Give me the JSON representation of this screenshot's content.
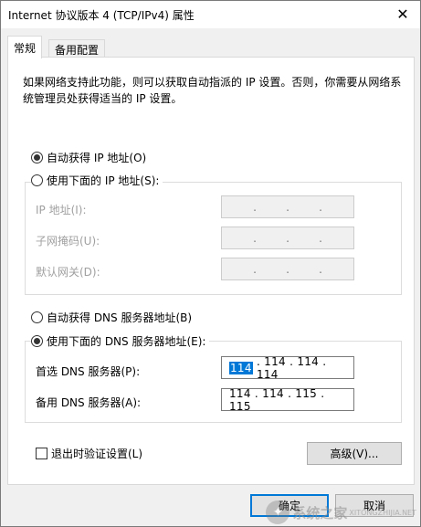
{
  "window": {
    "title": "Internet 协议版本 4 (TCP/IPv4) 属性",
    "close_glyph": "✕"
  },
  "tabs": [
    {
      "label": "常规",
      "active": true
    },
    {
      "label": "备用配置",
      "active": false
    }
  ],
  "description": "如果网络支持此功能，则可以获取自动指派的 IP 设置。否则，你需要从网络系统管理员处获得适当的 IP 设置。",
  "ip_section": {
    "auto_label": "自动获得 IP 地址(O)",
    "auto_checked": true,
    "manual_label": "使用下面的 IP 地址(S):",
    "manual_checked": false,
    "fields": [
      {
        "label": "IP 地址(I):",
        "value": "",
        "enabled": false
      },
      {
        "label": "子网掩码(U):",
        "value": "",
        "enabled": false
      },
      {
        "label": "默认网关(D):",
        "value": "",
        "enabled": false
      }
    ]
  },
  "dns_section": {
    "auto_label": "自动获得 DNS 服务器地址(B)",
    "auto_checked": false,
    "manual_label": "使用下面的 DNS 服务器地址(E):",
    "manual_checked": true,
    "preferred": {
      "label": "首选 DNS 服务器(P):",
      "first_octet": "114",
      "rest": ". 114 . 114 . 114"
    },
    "alternate": {
      "label": "备用 DNS 服务器(A):",
      "value": "114 . 114 . 115 . 115"
    }
  },
  "validate_on_exit": {
    "label": "退出时验证设置(L)",
    "checked": false
  },
  "buttons": {
    "advanced": "高级(V)...",
    "ok": "确定",
    "cancel": "取消"
  },
  "watermark": {
    "text": "系统之家",
    "url": "XITONGZHIJIA.NET"
  },
  "colors": {
    "selection": "#0078d7",
    "dialog_bg": "#f0f0f0",
    "panel_bg": "#ffffff"
  }
}
